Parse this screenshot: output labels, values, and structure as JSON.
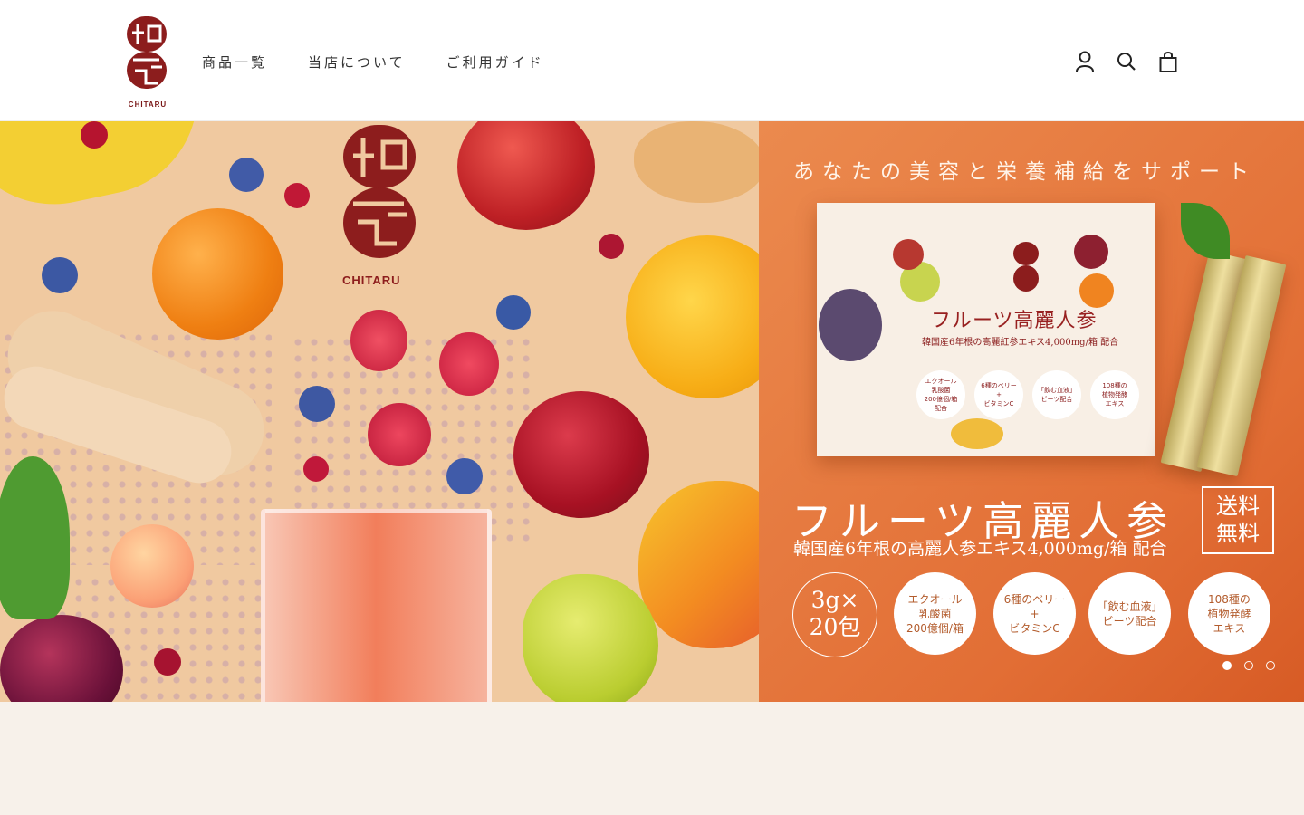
{
  "brand": {
    "name": "CHITARU",
    "logo_color": "#8c1d1d"
  },
  "nav": {
    "items": [
      {
        "label": "商品一覧"
      },
      {
        "label": "当店について"
      },
      {
        "label": "ご利用ガイド"
      }
    ]
  },
  "header_icons": {
    "account": "account-icon",
    "search": "search-icon",
    "cart": "shopping-bag-icon"
  },
  "hero": {
    "left_brand": "CHITARU",
    "tagline": "あなたの美容と栄養補給をサポート",
    "product_title": "フルーツ高麗人参",
    "product_subtitle": "韓国産6年根の高麗紅参エキス4,000mg/箱 配合",
    "main_title": "フルーツ高麗人参",
    "sub_title": "韓国産6年根の高麗人参エキス4,000mg/箱 配合",
    "free_shipping": [
      "送料",
      "無料"
    ],
    "pack": [
      "3g×",
      "20包"
    ],
    "features": [
      [
        "エクオール",
        "乳酸菌",
        "200億個/箱"
      ],
      [
        "6種のベリー",
        "+",
        "ビタミンC"
      ],
      [
        "「飲む血液」",
        "ビーツ配合"
      ],
      [
        "108種の",
        "植物発酵",
        "エキス"
      ]
    ],
    "box_features": [
      [
        "エクオール",
        "乳酸菌",
        "200億個/箱",
        "配合"
      ],
      [
        "6種のベリー",
        "+",
        "ビタミンC"
      ],
      [
        "「飲む血液」",
        "ビーツ配合"
      ],
      [
        "108種の",
        "植物発酵",
        "エキス"
      ]
    ],
    "slider": {
      "current": 1,
      "total": 3
    }
  },
  "colors": {
    "accent": "#8c1d1d",
    "hero_orange": "#e67440",
    "page_bg": "#f7f1ea"
  }
}
